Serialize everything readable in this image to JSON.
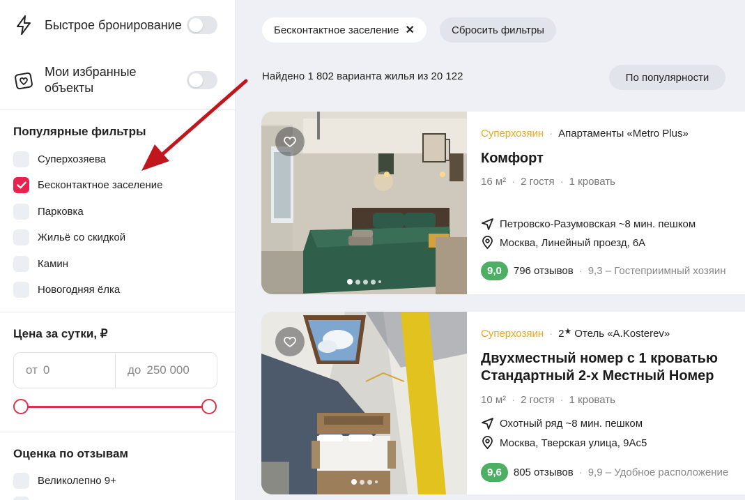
{
  "sidebar": {
    "toggles": [
      {
        "label": "Быстрое бронирование",
        "icon": "lightning-icon"
      },
      {
        "label": "Мои избранные объекты",
        "icon": "heart-frame-icon"
      }
    ],
    "popular_title": "Популярные фильтры",
    "popular_filters": [
      {
        "label": "Суперхозяева",
        "checked": false
      },
      {
        "label": "Бесконтактное заселение",
        "checked": true
      },
      {
        "label": "Парковка",
        "checked": false
      },
      {
        "label": "Жильё со скидкой",
        "checked": false
      },
      {
        "label": "Камин",
        "checked": false
      },
      {
        "label": "Новогодняя ёлка",
        "checked": false
      }
    ],
    "price_title": "Цена за сутки, ₽",
    "price_from_prefix": "от",
    "price_from": "0",
    "price_to_prefix": "до",
    "price_to": "250 000",
    "rating_title": "Оценка по отзывам",
    "rating_filters": [
      {
        "label": "Великолепно 9+",
        "checked": false
      }
    ]
  },
  "main": {
    "active_chip": "Бесконтактное заселение",
    "reset_chip": "Сбросить фильтры",
    "found_text": "Найдено 1 802 варианта жилья из 20 122",
    "sort_label": "По популярности"
  },
  "listings": [
    {
      "badge": "Суперхозяин",
      "stars": "",
      "property": "Апартаменты «Metro Plus»",
      "title_lines": [
        "Комфорт"
      ],
      "area": "16 м²",
      "guests": "2 гостя",
      "beds": "1 кровать",
      "metro": "Петровско-Разумовская ~8 мин. пешком",
      "address": "Москва, Линейный проезд, 6А",
      "score": "9,0",
      "reviews": "796 отзывов",
      "review_note": "9,3 – Гостеприимный хозяин"
    },
    {
      "badge": "Суперхозяин",
      "stars": "2",
      "property": "Отель «A.Kosterev»",
      "title_lines": [
        "Двухместный номер с 1 кроватью",
        "Стандартный 2-х Местный Номер"
      ],
      "area": "10 м²",
      "guests": "2 гостя",
      "beds": "1 кровать",
      "metro": "Охотный ряд ~8 мин. пешком",
      "address": "Москва, Тверская улица, 9Ас5",
      "score": "9,6",
      "reviews": "805 отзывов",
      "review_note": "9,9 – Удобное расположение"
    }
  ],
  "colors": {
    "accent": "#e8224f",
    "superhost": "#e9a81d",
    "score": "#4caf64",
    "annotation_arrow": "#c0171d"
  }
}
